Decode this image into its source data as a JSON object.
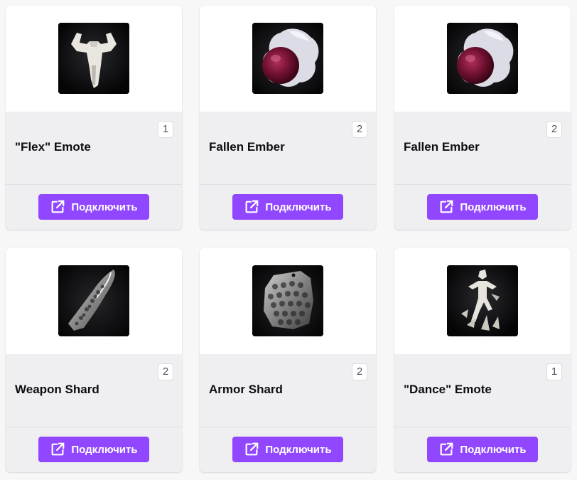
{
  "colors": {
    "accent": "#9147ff",
    "card_bg": "#efeff1",
    "thumb_bg": "#0b0b0d"
  },
  "items": [
    {
      "title": "\"Flex\" Emote",
      "quantity": "1",
      "icon": "flex-emote-icon",
      "button_label": "Подключить",
      "button_icon": "external-link-icon"
    },
    {
      "title": "Fallen Ember",
      "quantity": "2",
      "icon": "fallen-ember-icon",
      "button_label": "Подключить",
      "button_icon": "external-link-icon"
    },
    {
      "title": "Fallen Ember",
      "quantity": "2",
      "icon": "fallen-ember-icon",
      "button_label": "Подключить",
      "button_icon": "external-link-icon"
    },
    {
      "title": "Weapon Shard",
      "quantity": "2",
      "icon": "weapon-shard-icon",
      "button_label": "Подключить",
      "button_icon": "external-link-icon"
    },
    {
      "title": "Armor Shard",
      "quantity": "2",
      "icon": "armor-shard-icon",
      "button_label": "Подключить",
      "button_icon": "external-link-icon"
    },
    {
      "title": "\"Dance\" Emote",
      "quantity": "1",
      "icon": "dance-emote-icon",
      "button_label": "Подключить",
      "button_icon": "external-link-icon"
    }
  ]
}
